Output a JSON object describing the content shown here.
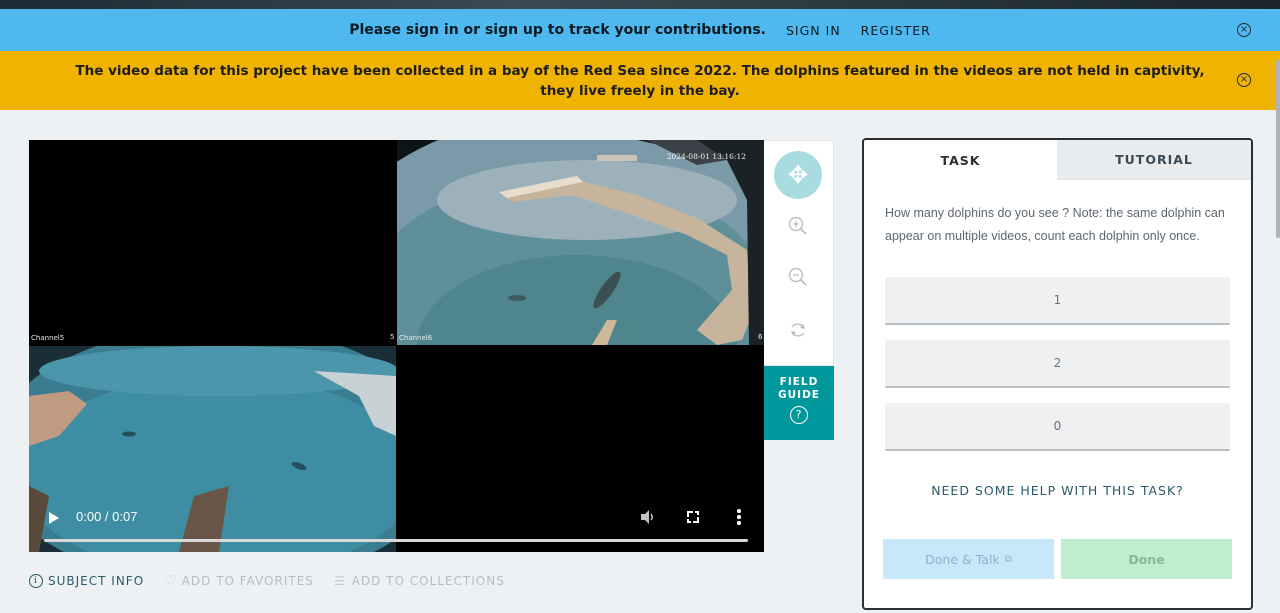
{
  "signin_bar": {
    "message": "Please sign in or sign up to track your contributions.",
    "sign_in": "SIGN IN",
    "register": "REGISTER",
    "close_glyph": "×"
  },
  "announcement": {
    "text": "The video data for this project have been collected in a bay of the Red Sea since 2022. The dolphins featured in the videos are not held in captivity, they live freely in the bay.",
    "close_glyph": "×"
  },
  "video": {
    "channel_tl": "Channel5",
    "channel_tl_suffix": "5",
    "channel_tr": "Channel6",
    "channel_tr_suffix": "6",
    "timestamp": "2024-08-01 13:16:12",
    "time": "0:00 / 0:07"
  },
  "toolbar": {
    "field_guide": "FIELD GUIDE",
    "field_guide_glyph": "?",
    "move_glyph": "✥"
  },
  "meta": {
    "subject_info": "SUBJECT INFO",
    "info_glyph": "i",
    "add_favorites": "ADD TO FAVORITES",
    "heart_glyph": "♡",
    "add_collections": "ADD TO COLLECTIONS",
    "list_glyph": "☰"
  },
  "task_panel": {
    "tab_task": "TASK",
    "tab_tutorial": "TUTORIAL",
    "question": "How many dolphins do you see ? Note: the same dolphin can appear on multiple videos, count each dolphin only once.",
    "answers": [
      "1",
      "2",
      "0"
    ],
    "help_link": "NEED SOME HELP WITH THIS TASK?",
    "done_talk": "Done & Talk",
    "external_glyph": "⧉",
    "done": "Done"
  },
  "colors": {
    "signin_bar": "#4fb8ef",
    "announcement": "#f0b300",
    "field_guide": "#00979d",
    "accent_text": "#2a5a6a"
  }
}
